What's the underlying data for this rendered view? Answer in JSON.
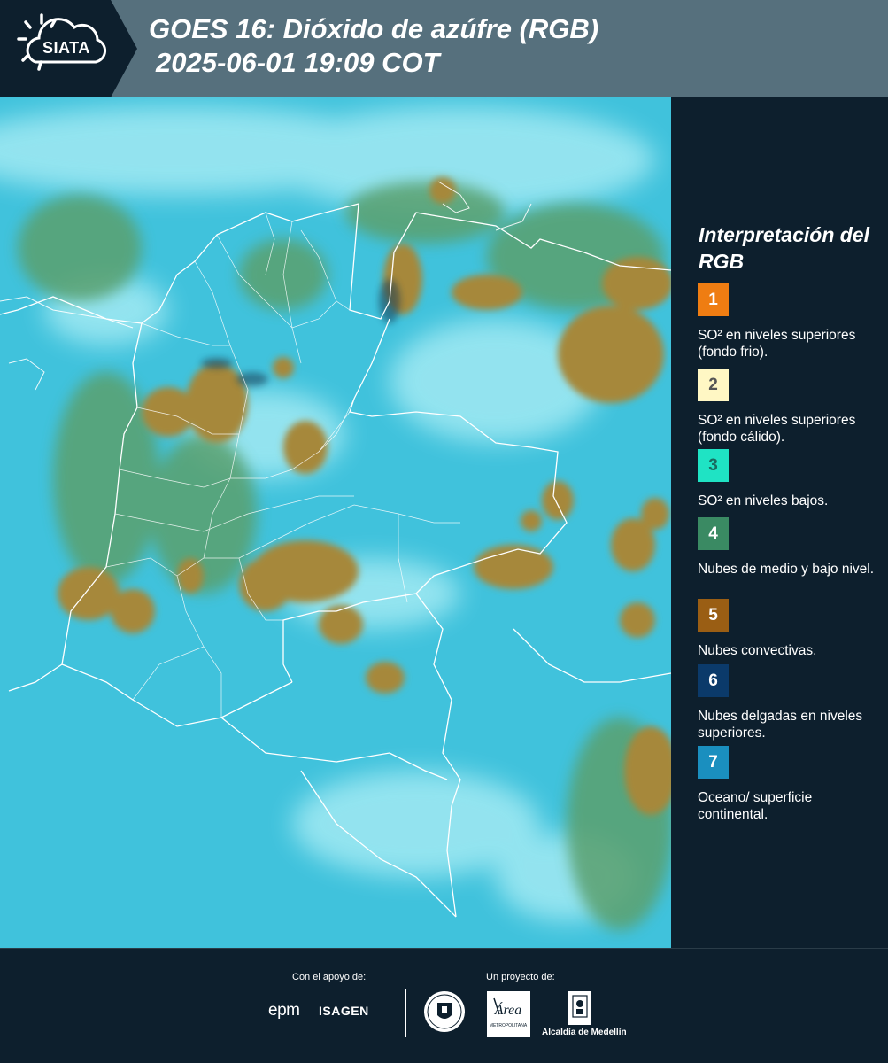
{
  "header": {
    "logo_text": "SIATA",
    "title_line1": "GOES 16: Dióxido de azúfre (RGB)",
    "title_line2": "2025-06-01 19:09 COT"
  },
  "map": {
    "icon": "satellite-map",
    "colors": {
      "background": "#40c2dc",
      "haze": "#a8ecf4",
      "lowclouds": "#5aa06e",
      "convective": "#a6883a",
      "boundary": "#ffffff"
    }
  },
  "legend": {
    "title": "Interpretación del RGB",
    "items": [
      {
        "number": "1",
        "color": "#ef7d12",
        "text_color": "#ffffff",
        "label": "SO² en niveles superiores (fondo frio)."
      },
      {
        "number": "2",
        "color": "#fff7c4",
        "text_color": "#555555",
        "label": "SO² en niveles superiores (fondo cálido)."
      },
      {
        "number": "3",
        "color": "#1fe3c4",
        "text_color": "#1a6b60",
        "label": "SO² en niveles bajos."
      },
      {
        "number": "4",
        "color": "#3a8a63",
        "text_color": "#ffffff",
        "label": "Nubes de medio y bajo nivel."
      },
      {
        "number": "5",
        "color": "#9a5e14",
        "text_color": "#ffffff",
        "label": "Nubes convectivas."
      },
      {
        "number": "6",
        "color": "#0b3a6a",
        "text_color": "#ffffff",
        "label": "Nubes delgadas en niveles superiores."
      },
      {
        "number": "7",
        "color": "#1a8fbf",
        "text_color": "#ffffff",
        "label": "Oceano/ superficie continental."
      }
    ]
  },
  "footer": {
    "support_label": "Con el apoyo de:",
    "project_label": "Un proyecto de:",
    "epm": "epm",
    "isagen": "ISAGEN",
    "area_text": "Área",
    "area_sub": "METROPOLITANA",
    "alcaldia": "Alcaldía de Medellín"
  }
}
